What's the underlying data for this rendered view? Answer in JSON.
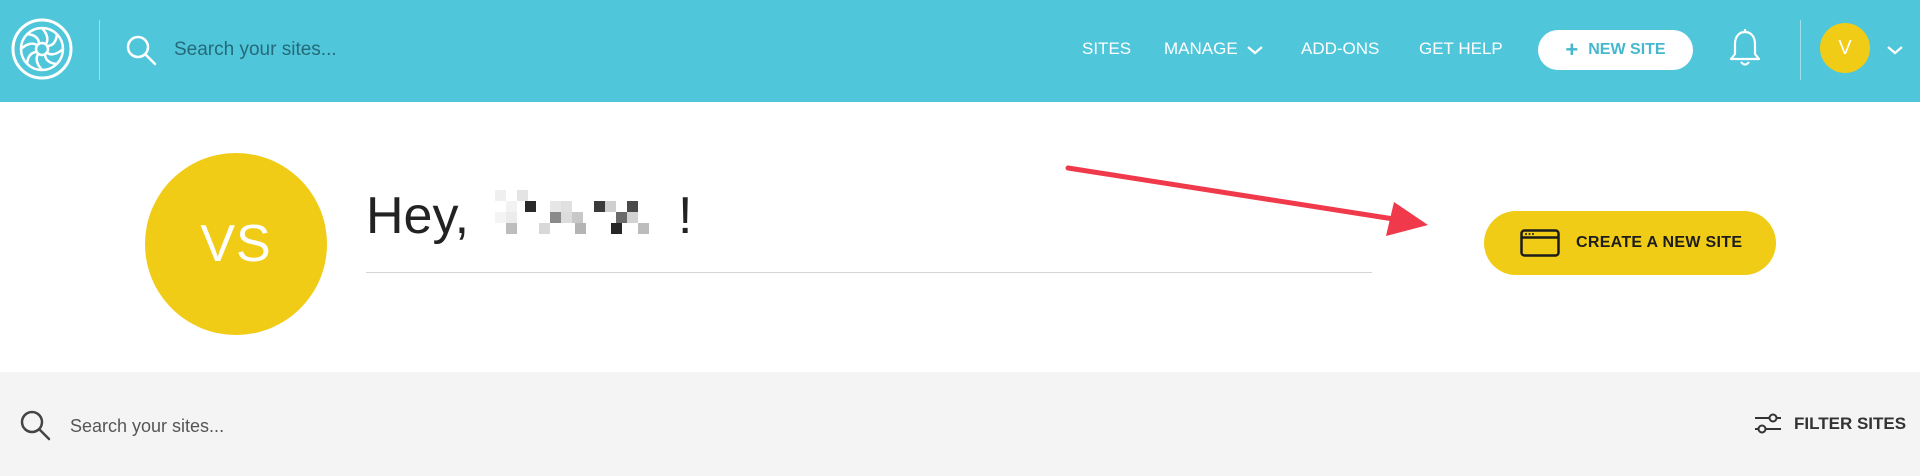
{
  "colors": {
    "topbar_bg": "#50c6db",
    "accent_yellow": "#f0cc16",
    "arrow_red": "#f0394a",
    "bottom_band_bg": "#f4f4f4"
  },
  "header": {
    "logo_icon": "flywheel-logo-icon",
    "search": {
      "icon": "search-icon",
      "placeholder": "Search your sites..."
    },
    "nav": {
      "sites": "SITES",
      "manage": "MANAGE",
      "addons": "ADD-ONS",
      "get_help": "GET HELP"
    },
    "new_site_button": {
      "icon": "plus-icon",
      "label": "NEW SITE"
    },
    "notifications_icon": "bell-icon",
    "user": {
      "initial": "V",
      "menu_icon": "chevron-down-icon"
    }
  },
  "greeting": {
    "avatar_initials": "VS",
    "prefix": "Hey,",
    "name_redacted_icon": "pixelated-redaction",
    "suffix": "!"
  },
  "create_button": {
    "icon": "browser-window-icon",
    "label": "CREATE A NEW SITE"
  },
  "annotation": {
    "arrow_icon": "red-arrow-annotation"
  },
  "sites_toolbar": {
    "search": {
      "icon": "search-icon",
      "placeholder": "Search your sites..."
    },
    "filter": {
      "icon": "sliders-icon",
      "label": "FILTER SITES"
    }
  }
}
